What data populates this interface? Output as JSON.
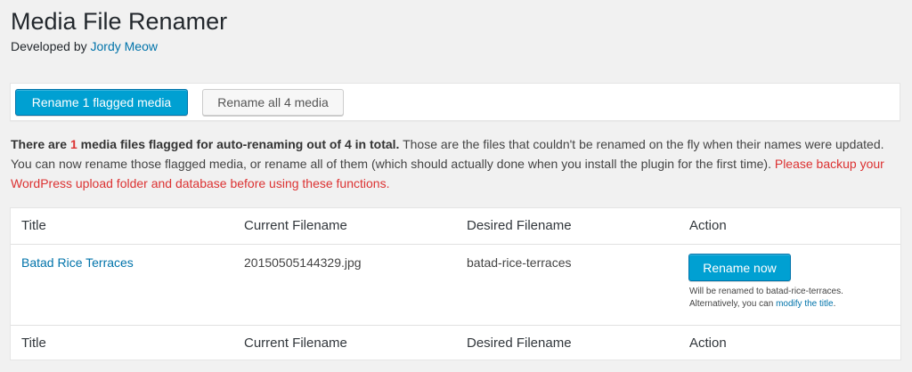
{
  "header": {
    "title": "Media File Renamer",
    "developed_by": "Developed by",
    "author": "Jordy Meow"
  },
  "toolbar": {
    "rename_flagged_label": "Rename 1 flagged media",
    "rename_all_label": "Rename all 4 media"
  },
  "notice": {
    "bold_prefix": "There are ",
    "flagged_count": "1",
    "bold_suffix": " media files flagged for auto-renaming out of 4 in total.",
    "body": " Those are the files that couldn't be renamed on the fly when their names were updated. You can now rename those flagged media, or rename all of them (which should actually done when you install the plugin for the first time).",
    "warning": "Please backup your WordPress upload folder and database before using these functions."
  },
  "table": {
    "columns": [
      "Title",
      "Current Filename",
      "Desired Filename",
      "Action"
    ],
    "rows": [
      {
        "title": "Batad Rice Terraces",
        "current_filename": "20150505144329.jpg",
        "desired_filename": "batad-rice-terraces",
        "action_label": "Rename now",
        "note_line1": "Will be renamed to batad-rice-terraces.",
        "note_line2_prefix": "Alternatively, you can ",
        "note_link": "modify the title",
        "note_line2_suffix": "."
      }
    ]
  },
  "colors": {
    "primary": "#00a0d2",
    "link": "#0073aa",
    "warning": "#dc3232"
  }
}
